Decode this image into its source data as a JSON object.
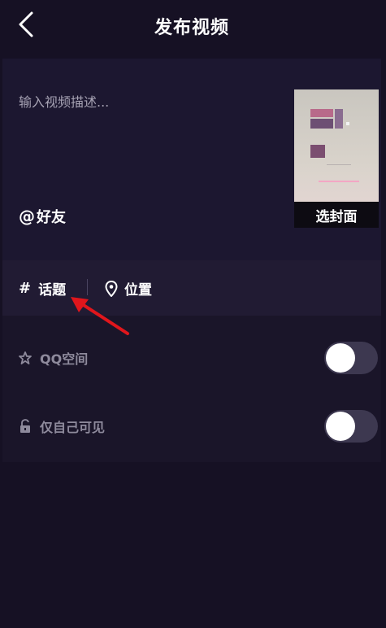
{
  "header": {
    "title": "发布视频",
    "back_icon": "chevron-left-icon"
  },
  "description": {
    "placeholder": "输入视频描述..."
  },
  "mention": {
    "symbol": "@",
    "label": "好友"
  },
  "cover": {
    "button_label": "选封面"
  },
  "tags": {
    "topic": {
      "icon": "#",
      "label": "话题"
    },
    "location": {
      "icon": "location-pin-icon",
      "label": "位置"
    }
  },
  "privacy": {
    "rows": [
      {
        "icon": "star-icon",
        "label": "QQ空间",
        "enabled": false
      },
      {
        "icon": "unlock-icon",
        "label": "仅自己可见",
        "enabled": false
      }
    ]
  },
  "colors": {
    "background": "#161124",
    "section": "#1c1730",
    "annotation_arrow": "#e0161c"
  }
}
